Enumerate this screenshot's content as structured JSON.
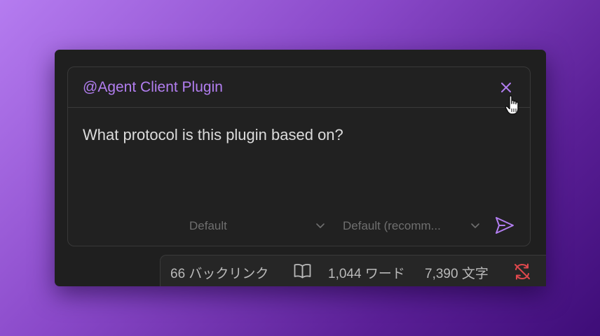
{
  "chat": {
    "mention": "@Agent Client Plugin",
    "message": "What protocol is this plugin based on?",
    "mode_select": "Default",
    "model_select": "Default (recomm...",
    "close_icon": "close-icon",
    "send_icon": "send-icon"
  },
  "statusbar": {
    "backlinks": "66 バックリンク",
    "words": "1,044 ワード",
    "chars": "7,390 文字",
    "book_icon": "book-open-icon",
    "sync_icon": "sync-off-icon"
  },
  "colors": {
    "accent": "#b27ef0",
    "sync_error": "#e0484d",
    "background_gradient_start": "#b57cf0",
    "background_gradient_end": "#3e0d78"
  }
}
